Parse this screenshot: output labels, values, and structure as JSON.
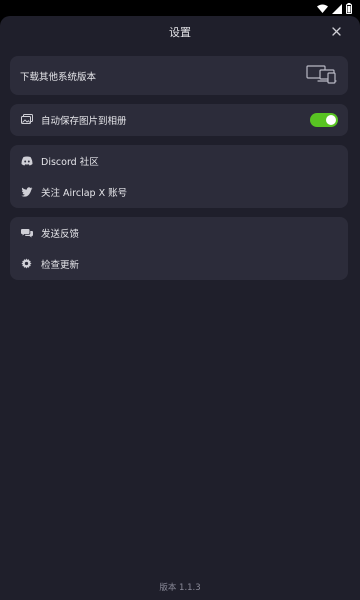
{
  "statusbar": {
    "icons": [
      "wifi-icon",
      "signal-icon",
      "battery-icon"
    ]
  },
  "dialog": {
    "title": "设置",
    "close_icon": "close-icon"
  },
  "download": {
    "label": "下载其他系统版本",
    "icon": "devices-icon"
  },
  "autosave": {
    "label": "自动保存图片到相册",
    "icon": "photos-icon",
    "toggle_on": true,
    "toggle_color": "#58c322"
  },
  "social": {
    "discord_label": "Discord 社区",
    "twitter_label": "关注 Airclap X 账号"
  },
  "support": {
    "feedback_label": "发送反馈",
    "update_label": "检查更新"
  },
  "footer": {
    "version": "版本 1.1.3"
  },
  "colors": {
    "background": "#1f1f2b",
    "card": "#2c2c3a",
    "text": "#e6e6ea",
    "muted": "#8a8a98",
    "accent": "#58c322"
  }
}
